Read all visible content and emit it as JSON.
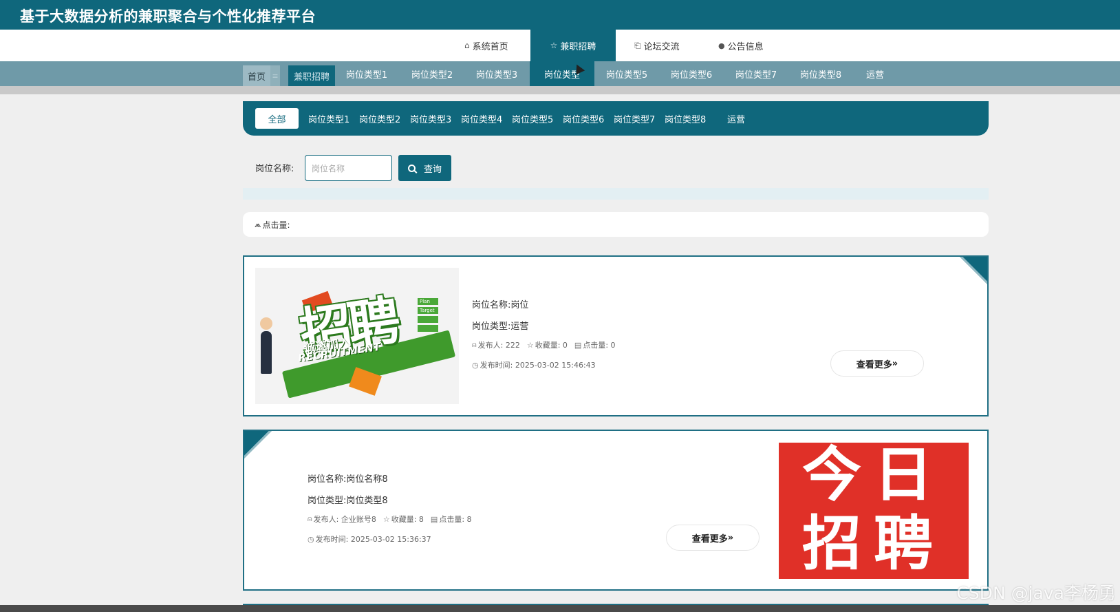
{
  "site_title": "基于大数据分析的兼职聚合与个性化推荐平台",
  "main_nav": [
    {
      "icon": "home-icon",
      "glyph": "⌂",
      "label": "系统首页"
    },
    {
      "icon": "star-icon",
      "glyph": "☆",
      "label": "兼职招聘"
    },
    {
      "icon": "bag-icon",
      "glyph": "⎗",
      "label": "论坛交流"
    },
    {
      "icon": "info-icon",
      "glyph": "●",
      "label": "公告信息"
    }
  ],
  "breadcrumb": {
    "home": "首页",
    "separator": "≡",
    "current": "兼职招聘"
  },
  "sub_nav": [
    "岗位类型1",
    "岗位类型2",
    "岗位类型3",
    "岗位类型",
    "岗位类型5",
    "岗位类型6",
    "岗位类型7",
    "岗位类型8",
    "运营"
  ],
  "filter": {
    "all_label": "全部",
    "items": [
      "岗位类型1",
      "岗位类型2",
      "岗位类型3",
      "岗位类型4",
      "岗位类型5",
      "岗位类型6",
      "岗位类型7",
      "岗位类型8",
      "运营"
    ]
  },
  "search": {
    "label": "岗位名称:",
    "placeholder": "岗位名称",
    "button": "查询"
  },
  "sort": {
    "label": "点击量:"
  },
  "jobs": [
    {
      "name": "岗位名称:岗位",
      "type": "岗位类型:运营",
      "publisher_label": "发布人:",
      "publisher": "222",
      "favorites_label": "收藏量:",
      "favorites": "0",
      "clicks_label": "点击量:",
      "clicks": "0",
      "time_label": "发布时间:",
      "time": "2025-03-02 15:46:43",
      "more": "查看更多",
      "image_text": {
        "big": "招聘",
        "sub": "诚邀加入",
        "en": "RECRUITMENT",
        "tags": [
          "Plan",
          "Target",
          "",
          "",
          ""
        ]
      }
    },
    {
      "name": "岗位名称:岗位名称8",
      "type": "岗位类型:岗位类型8",
      "publisher_label": "发布人:",
      "publisher": "企业账号8",
      "favorites_label": "收藏量:",
      "favorites": "8",
      "clicks_label": "点击量:",
      "clicks": "8",
      "time_label": "发布时间:",
      "time": "2025-03-02 15:36:37",
      "more": "查看更多",
      "image_text": {
        "line1": "今日",
        "line2": "招聘"
      }
    }
  ],
  "watermark": "CSDN @java李杨勇",
  "colors": {
    "primary": "#0f677c",
    "subnav": "#6f9aa8",
    "background": "#efefef"
  }
}
